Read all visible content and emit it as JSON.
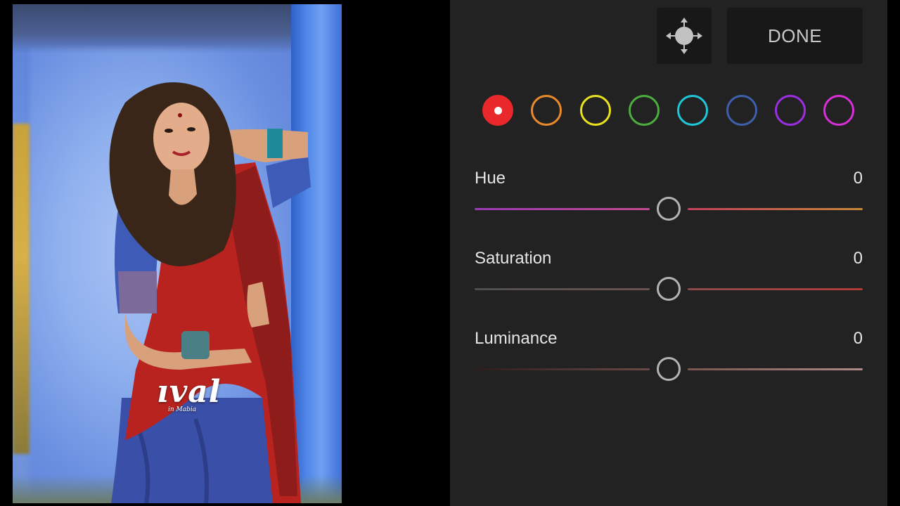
{
  "photo": {
    "watermark_main": "ıval",
    "watermark_sub": "in Mabia"
  },
  "toolbar": {
    "target_tool_icon": "targeted-adjustment-icon",
    "done_label": "DONE"
  },
  "colors": {
    "panel_bg": "#222222",
    "button_bg": "#181818",
    "selected_swatch_fill": "#e8282b"
  },
  "color_swatches": [
    {
      "name": "red",
      "color": "#e8282b",
      "selected": true
    },
    {
      "name": "orange",
      "color": "#ea8a2a",
      "selected": false
    },
    {
      "name": "yellow",
      "color": "#e9e21f",
      "selected": false
    },
    {
      "name": "green",
      "color": "#4cae3f",
      "selected": false
    },
    {
      "name": "aqua",
      "color": "#1fc7d8",
      "selected": false
    },
    {
      "name": "blue",
      "color": "#3d5fae",
      "selected": false
    },
    {
      "name": "purple",
      "color": "#9b2ee0",
      "selected": false
    },
    {
      "name": "magenta",
      "color": "#d92fd9",
      "selected": false
    }
  ],
  "sliders": [
    {
      "id": "hue",
      "label": "Hue",
      "value": "0",
      "position": 0.5,
      "left_track": [
        "#9a3ab5",
        "#c24a8f"
      ],
      "right_track": [
        "#c2405a",
        "#c7863a"
      ]
    },
    {
      "id": "saturation",
      "label": "Saturation",
      "value": "0",
      "position": 0.5,
      "left_track": [
        "#4f4f4f",
        "#6a5350"
      ],
      "right_track": [
        "#8a4a4a",
        "#b03a3a"
      ]
    },
    {
      "id": "luminance",
      "label": "Luminance",
      "value": "0",
      "position": 0.5,
      "left_track": [
        "#2c1c1c",
        "#6a4a46"
      ],
      "right_track": [
        "#7a5550",
        "#b08a86"
      ]
    }
  ]
}
